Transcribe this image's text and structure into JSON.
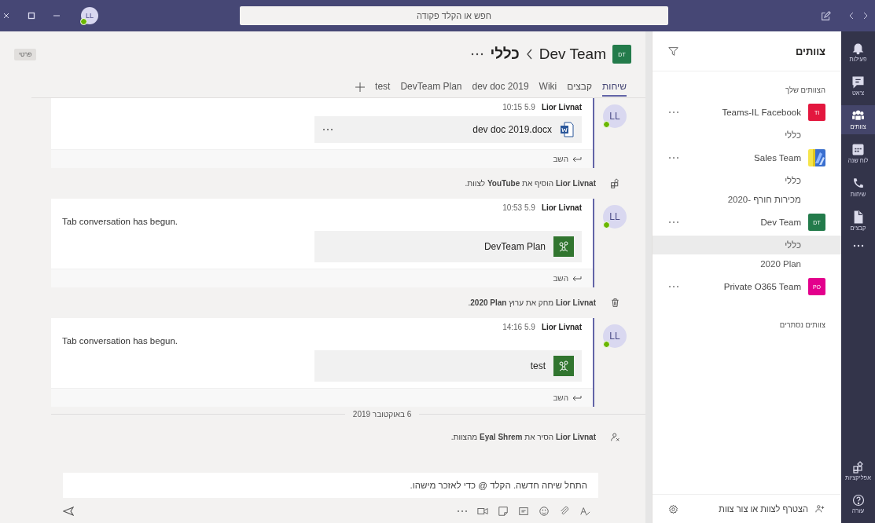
{
  "top_bar": {
    "search": {
      "placeholder": "חפש או הקלד פקודה"
    },
    "user": {
      "initials": "LL",
      "online": true
    }
  },
  "app_rail": {
    "items": [
      {
        "label": "פעילות",
        "kind": "bell",
        "selected": false
      },
      {
        "label": "צ'אט",
        "kind": "chat",
        "selected": false
      },
      {
        "label": "צוותים",
        "kind": "teams",
        "selected": true
      },
      {
        "label": "לוח שנה",
        "kind": "calendar",
        "selected": false
      },
      {
        "label": "שיחות",
        "kind": "phone",
        "selected": false
      },
      {
        "label": "קבצים",
        "kind": "file",
        "selected": false
      },
      {
        "kind": "more",
        "selected": false
      }
    ],
    "bottom_items": [
      {
        "label": "אפליקציות",
        "kind": "apps",
        "selected": false
      },
      {
        "label": "עזרה",
        "kind": "help",
        "selected": false
      }
    ]
  },
  "teams_panel": {
    "title": "צוותים",
    "section": "הצוותים שלך",
    "teams": [
      {
        "name": "Teams-IL Facebook",
        "initials": "TI",
        "color": "#e3173e",
        "channels": [
          {
            "name": "כללי",
            "selected": false
          }
        ]
      },
      {
        "name": "Sales Team",
        "channels": [
          {
            "name": "כללי",
            "selected": false
          },
          {
            "name": "מכירות חורף -2020",
            "selected": false
          }
        ]
      },
      {
        "name": "Dev Team",
        "initials": "DT",
        "color": "#237b4b",
        "channels": [
          {
            "name": "כללי",
            "selected": true
          },
          {
            "name": "2020 Plan",
            "selected": false
          }
        ]
      },
      {
        "name": "Private O365 Team",
        "initials": "PO",
        "color": "#e3008c"
      }
    ],
    "hidden_section": "צוותים נסתרים",
    "join": "הצטרף לצוות או צור צוות"
  },
  "channel_header": {
    "team_initials": "DT",
    "team_name": "Dev Team",
    "channel": "כללי",
    "privacy": "פרטי",
    "tabs": [
      {
        "label": "שיחות",
        "selected": true
      },
      {
        "label": "קבצים",
        "selected": false
      },
      {
        "label": "Wiki",
        "selected": false
      },
      {
        "label": "dev doc 2019",
        "selected": false
      },
      {
        "label": "DevTeam Plan",
        "selected": false
      },
      {
        "label": "test",
        "selected": false
      }
    ]
  },
  "feed": [
    {
      "kind": "message",
      "initials": "LL",
      "online": true,
      "author": "Lior Livnat",
      "time": "10:15 5.9",
      "attachment": {
        "kind": "word",
        "name": "dev doc 2019.docx"
      },
      "reply": "השב"
    },
    {
      "kind": "app-added",
      "actor": "Lior Livnat",
      "action": "הוסיף את",
      "object": "YouTube",
      "suffix": " לצוות."
    },
    {
      "kind": "message",
      "initials": "LL",
      "online": true,
      "author": "Lior Livnat",
      "time": "10:53 5.9",
      "text": "Tab conversation has begun.",
      "attachment": {
        "kind": "planner",
        "name": "DevTeam Plan"
      },
      "reply": "השב"
    },
    {
      "kind": "channel-deleted",
      "actor": "Lior Livnat",
      "action": "מחק את ערוץ",
      "object": "2020 Plan",
      "suffix": "."
    },
    {
      "kind": "message",
      "initials": "LL",
      "online": true,
      "author": "Lior Livnat",
      "time": "14:16 5.9",
      "text": "Tab conversation has begun.",
      "attachment": {
        "kind": "planner",
        "name": "test"
      },
      "reply": "השב"
    },
    {
      "kind": "date",
      "text": "6 באוקטובר 2019"
    },
    {
      "kind": "member-removed",
      "actor": "Lior Livnat",
      "action": "הסיר את",
      "object": "Eyal Shrem",
      "suffix": " מהצוות."
    }
  ],
  "composer": {
    "placeholder": "התחל שיחה חדשה. הקלד @ כדי לאזכר מישהו."
  }
}
